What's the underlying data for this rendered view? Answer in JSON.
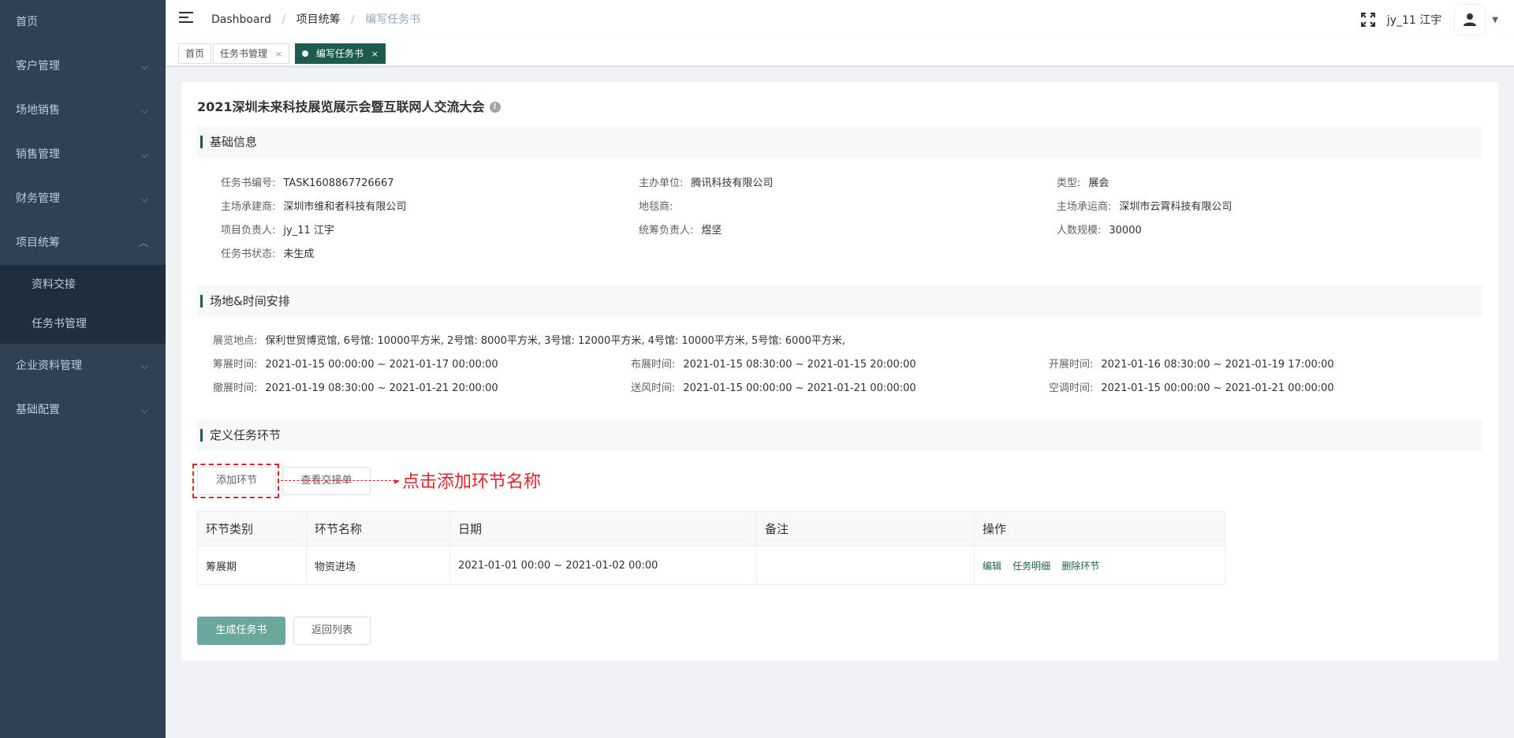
{
  "sidebar": {
    "items": [
      {
        "label": "首页",
        "has_arrow": false
      },
      {
        "label": "客户管理",
        "has_arrow": true
      },
      {
        "label": "场地销售",
        "has_arrow": true
      },
      {
        "label": "销售管理",
        "has_arrow": true
      },
      {
        "label": "财务管理",
        "has_arrow": true
      },
      {
        "label": "项目统筹",
        "has_arrow": true,
        "expanded": true
      },
      {
        "label": "企业资料管理",
        "has_arrow": true
      },
      {
        "label": "基础配置",
        "has_arrow": true
      }
    ],
    "sub_items": [
      {
        "label": "资料交接"
      },
      {
        "label": "任务书管理"
      }
    ]
  },
  "navbar": {
    "breadcrumb": [
      "Dashboard",
      "项目统筹",
      "编写任务书"
    ],
    "username": "jy_11 江宇"
  },
  "tags": [
    {
      "label": "首页",
      "closable": false,
      "active": false
    },
    {
      "label": "任务书管理",
      "closable": true,
      "active": false
    },
    {
      "label": "编写任务书",
      "closable": true,
      "active": true
    }
  ],
  "page": {
    "title": "2021深圳未来科技展览展示会暨互联网人交流大会"
  },
  "basic_info": {
    "section_title": "基础信息",
    "fields": [
      {
        "label": "任务书编号:",
        "value": "TASK1608867726667"
      },
      {
        "label": "主办单位:",
        "value": "腾讯科技有限公司"
      },
      {
        "label": "类型:",
        "value": "展会"
      },
      {
        "label": "主场承建商:",
        "value": "深圳市维和者科技有限公司"
      },
      {
        "label": "地毯商:",
        "value": ""
      },
      {
        "label": "主场承运商:",
        "value": "深圳市云霄科技有限公司"
      },
      {
        "label": "项目负责人:",
        "value": "jy_11 江宇"
      },
      {
        "label": "统筹负责人:",
        "value": "煜坚"
      },
      {
        "label": "人数规模:",
        "value": "30000"
      },
      {
        "label": "任务书状态:",
        "value": "未生成"
      }
    ]
  },
  "venue_info": {
    "section_title": "场地&时间安排",
    "location": {
      "label": "展览地点:",
      "value": "保利世贸博览馆, 6号馆: 10000平方米, 2号馆: 8000平方米, 3号馆: 12000平方米, 4号馆: 10000平方米, 5号馆: 6000平方米,"
    },
    "times": [
      {
        "label": "筹展时间:",
        "value": "2021-01-15 00:00:00 ~ 2021-01-17 00:00:00"
      },
      {
        "label": "布展时间:",
        "value": "2021-01-15 08:30:00 ~ 2021-01-15 20:00:00"
      },
      {
        "label": "开展时间:",
        "value": "2021-01-16 08:30:00 ~ 2021-01-19 17:00:00"
      },
      {
        "label": "撤展时间:",
        "value": "2021-01-19 08:30:00 ~ 2021-01-21 20:00:00"
      },
      {
        "label": "送风时间:",
        "value": "2021-01-15 00:00:00 ~ 2021-01-21 00:00:00"
      },
      {
        "label": "空调时间:",
        "value": "2021-01-15 00:00:00 ~ 2021-01-21 00:00:00"
      }
    ]
  },
  "task_section": {
    "section_title": "定义任务环节",
    "add_button": "添加环节",
    "view_button": "查看交接单",
    "annotation": "点击添加环节名称",
    "table": {
      "headers": [
        "环节类别",
        "环节名称",
        "日期",
        "备注",
        "操作"
      ],
      "rows": [
        {
          "category": "筹展期",
          "name": "物资进场",
          "date": "2021-01-01 00:00 ~ 2021-01-02 00:00",
          "note": "",
          "ops": [
            "编辑",
            "任务明细",
            "删除环节"
          ]
        }
      ]
    }
  },
  "footer_buttons": {
    "generate": "生成任务书",
    "back": "返回列表"
  },
  "colors": {
    "sidebar_bg": "#304156",
    "accent": "#1e5b4f",
    "primary_button": "#6ca79d",
    "annotation_red": "#e0242a"
  }
}
